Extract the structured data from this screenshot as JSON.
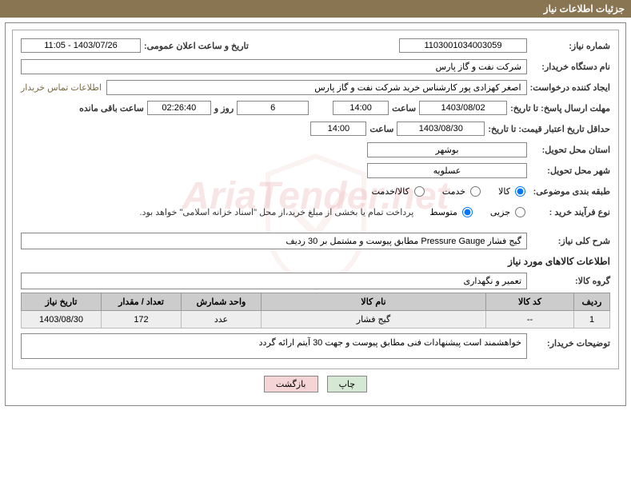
{
  "header": {
    "title": "جزئیات اطلاعات نیاز"
  },
  "fields": {
    "need_no_label": "شماره نیاز:",
    "need_no": "1103001034003059",
    "announce_label": "تاریخ و ساعت اعلان عمومی:",
    "announce": "1403/07/26 - 11:05",
    "buyer_org_label": "نام دستگاه خریدار:",
    "buyer_org": "شرکت نفت و گاز پارس",
    "requester_label": "ایجاد کننده درخواست:",
    "requester": "اصغر کهزادی پور کارشناس خرید شرکت نفت و گاز پارس",
    "contact_link": "اطلاعات تماس خریدار",
    "deadline_label": "مهلت ارسال پاسخ: تا تاریخ:",
    "deadline_date": "1403/08/02",
    "time_label": "ساعت",
    "deadline_time": "14:00",
    "days_remain": "6",
    "days_label": "روز و",
    "countdown": "02:26:40",
    "remain_label": "ساعت باقی مانده",
    "validity_label": "حداقل تاریخ اعتبار قیمت: تا تاریخ:",
    "validity_date": "1403/08/30",
    "validity_time": "14:00",
    "province_label": "استان محل تحویل:",
    "province": "بوشهر",
    "city_label": "شهر محل تحویل:",
    "city": "عسلویه",
    "category_label": "طبقه بندی موضوعی:",
    "cat_goods": "کالا",
    "cat_service": "خدمت",
    "cat_both": "کالا/خدمت",
    "process_label": "نوع فرآیند خرید :",
    "proc_minor": "جزیی",
    "proc_medium": "متوسط",
    "proc_note": "پرداخت تمام یا بخشی از مبلغ خرید،از محل \"اسناد خزانه اسلامی\" خواهد بود.",
    "desc_label": "شرح کلی نیاز:",
    "desc": "گیج فشار Pressure Gauge مطابق پیوست و مشتمل بر 30 ردیف",
    "items_title": "اطلاعات کالاهای مورد نیاز",
    "group_label": "گروه کالا:",
    "group": "تعمیر و نگهداری",
    "buyer_note_label": "توضیحات خریدار:",
    "buyer_note": "خواهشمند است پیشنهادات فنی مطابق پیوست و جهت 30 آیتم ارائه گردد"
  },
  "table": {
    "headers": {
      "row": "ردیف",
      "code": "کد کالا",
      "name": "نام کالا",
      "unit": "واحد شمارش",
      "qty": "تعداد / مقدار",
      "date": "تاریخ نیاز"
    },
    "rows": [
      {
        "row": "1",
        "code": "--",
        "name": "گیج فشار",
        "unit": "عدد",
        "qty": "172",
        "date": "1403/08/30"
      }
    ]
  },
  "buttons": {
    "print": "چاپ",
    "back": "بازگشت"
  },
  "watermark": "AriaTender.net"
}
